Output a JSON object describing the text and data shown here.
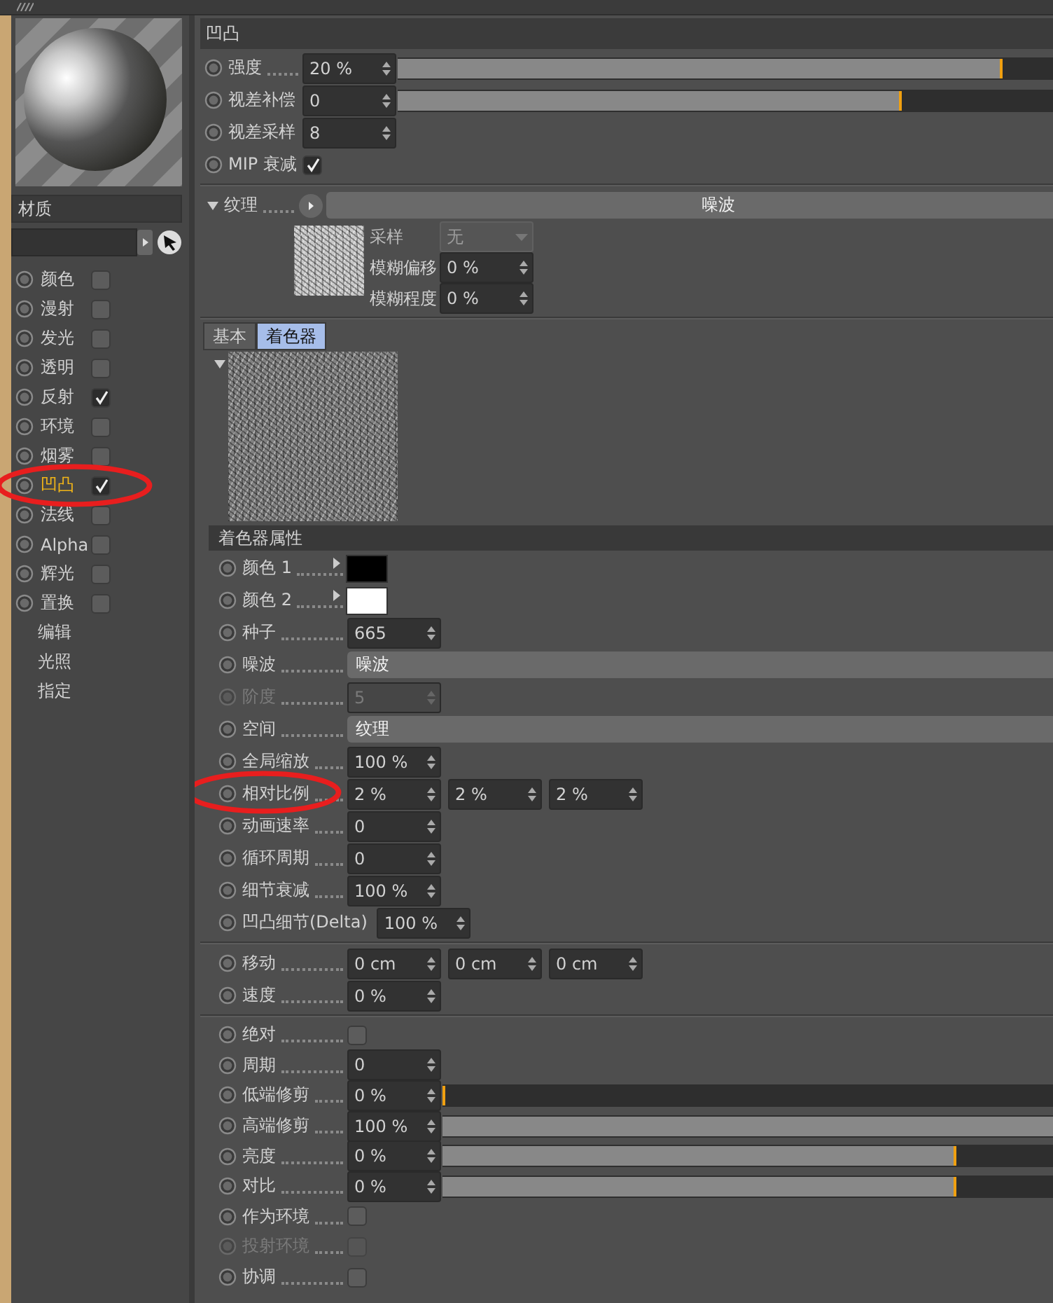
{
  "material": {
    "name": "材质",
    "channels": [
      {
        "label": "颜色",
        "checked": false,
        "selected": false,
        "circled": false
      },
      {
        "label": "漫射",
        "checked": false,
        "selected": false,
        "circled": false
      },
      {
        "label": "发光",
        "checked": false,
        "selected": false,
        "circled": false
      },
      {
        "label": "透明",
        "checked": false,
        "selected": false,
        "circled": false
      },
      {
        "label": "反射",
        "checked": true,
        "selected": false,
        "circled": false
      },
      {
        "label": "环境",
        "checked": false,
        "selected": false,
        "circled": false
      },
      {
        "label": "烟雾",
        "checked": false,
        "selected": false,
        "circled": false
      },
      {
        "label": "凹凸",
        "checked": true,
        "selected": true,
        "circled": true
      },
      {
        "label": "法线",
        "checked": false,
        "selected": false,
        "circled": false
      },
      {
        "label": "Alpha",
        "checked": false,
        "selected": false,
        "circled": false
      },
      {
        "label": "辉光",
        "checked": false,
        "selected": false,
        "circled": false
      },
      {
        "label": "置换",
        "checked": false,
        "selected": false,
        "circled": false
      }
    ],
    "pages": [
      {
        "label": "编辑"
      },
      {
        "label": "光照"
      },
      {
        "label": "指定"
      }
    ]
  },
  "panel": {
    "title": "凹凸",
    "params": [
      {
        "kind": "slider",
        "label": "强度",
        "value": "20 %",
        "level": 0.9
      },
      {
        "kind": "slider",
        "label": "视差补偿",
        "value": "0",
        "level": 0.75
      },
      {
        "kind": "number",
        "label": "视差采样",
        "value": "8"
      },
      {
        "kind": "checkbox",
        "label": "MIP 衰减",
        "checked": true
      }
    ],
    "texture": {
      "label": "纹理",
      "value": "噪波",
      "expanded": true,
      "options": [
        {
          "kind": "dropdown",
          "label": "采样",
          "value": "无",
          "disabled": true
        },
        {
          "kind": "number",
          "label": "模糊偏移",
          "value": "0 %",
          "disabled": false
        },
        {
          "kind": "number",
          "label": "模糊程度",
          "value": "0 %",
          "disabled": false
        }
      ]
    },
    "tabs": [
      {
        "label": "基本",
        "selected": false
      },
      {
        "label": "着色器",
        "selected": true
      }
    ],
    "shader": {
      "title": "着色器属性",
      "expanded": true,
      "groups": [
        [
          {
            "kind": "color",
            "label": "颜色 1",
            "color": "#000000",
            "disabled": false,
            "circled": false
          },
          {
            "kind": "color",
            "label": "颜色 2",
            "color": "#ffffff",
            "disabled": false,
            "circled": false
          },
          {
            "kind": "number",
            "label": "种子",
            "value": "665",
            "disabled": false,
            "circled": false
          },
          {
            "kind": "dropdown",
            "label": "噪波",
            "value": "噪波",
            "disabled": false,
            "circled": false
          },
          {
            "kind": "number",
            "label": "阶度",
            "value": "5",
            "disabled": true,
            "circled": false
          },
          {
            "kind": "dropdown",
            "label": "空间",
            "value": "纹理",
            "disabled": false,
            "circled": false
          },
          {
            "kind": "number",
            "label": "全局缩放",
            "value": "100 %",
            "disabled": false,
            "circled": false
          },
          {
            "kind": "vector",
            "label": "相对比例",
            "values": [
              "2 %",
              "2 %",
              "2 %"
            ],
            "disabled": false,
            "circled": true
          },
          {
            "kind": "number",
            "label": "动画速率",
            "value": "0",
            "disabled": false,
            "circled": false
          },
          {
            "kind": "number",
            "label": "循环周期",
            "value": "0",
            "disabled": false,
            "circled": false
          },
          {
            "kind": "number",
            "label": "细节衰减",
            "value": "100 %",
            "disabled": false,
            "circled": false
          },
          {
            "kind": "number",
            "label": "凹凸细节(Delta)",
            "value": "100 %",
            "disabled": false,
            "circled": false
          }
        ],
        [
          {
            "kind": "vector",
            "label": "移动",
            "values": [
              "0 cm",
              "0 cm",
              "0 cm"
            ],
            "disabled": false,
            "circled": false
          },
          {
            "kind": "number",
            "label": "速度",
            "value": "0 %",
            "disabled": false,
            "circled": false
          }
        ],
        [
          {
            "kind": "checkbox",
            "label": "绝对",
            "checked": false,
            "disabled": false,
            "circled": false
          },
          {
            "kind": "number",
            "label": "周期",
            "value": "0",
            "disabled": false,
            "circled": false
          },
          {
            "kind": "slider",
            "label": "低端修剪",
            "value": "0 %",
            "level": 0,
            "disabled": false,
            "circled": false
          },
          {
            "kind": "slider",
            "label": "高端修剪",
            "value": "100 %",
            "level": 1,
            "disabled": false,
            "circled": false
          },
          {
            "kind": "slider",
            "label": "亮度",
            "value": "0 %",
            "level": 0.764,
            "disabled": false,
            "circled": false
          },
          {
            "kind": "slider",
            "label": "对比",
            "value": "0 %",
            "level": 0.764,
            "disabled": false,
            "circled": false
          },
          {
            "kind": "checkbox",
            "label": "作为环境",
            "checked": false,
            "disabled": false,
            "circled": false
          },
          {
            "kind": "checkbox",
            "label": "投射环境",
            "checked": false,
            "disabled": true,
            "circled": false
          },
          {
            "kind": "checkbox",
            "label": "协调",
            "checked": false,
            "disabled": false,
            "circled": false
          }
        ]
      ]
    }
  }
}
